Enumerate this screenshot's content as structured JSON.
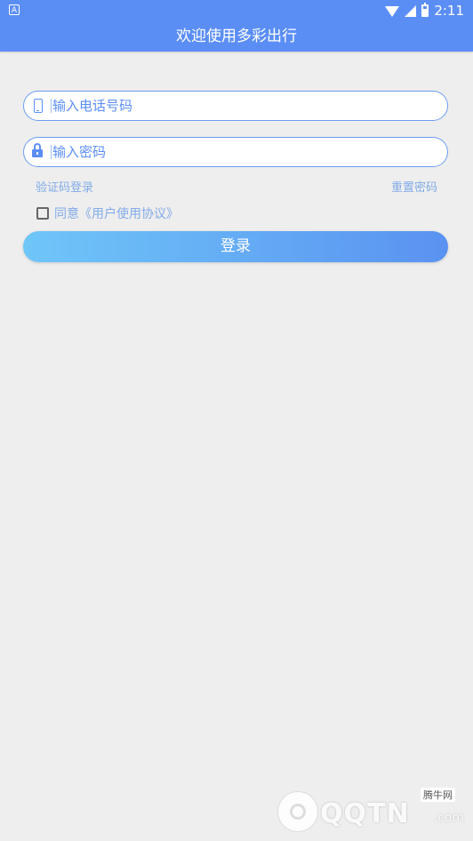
{
  "status_bar": {
    "time": "2:11",
    "notification_badge": "A"
  },
  "app_bar": {
    "title": "欢迎使用多彩出行"
  },
  "form": {
    "phone_placeholder": "输入电话号码",
    "password_placeholder": "输入密码",
    "sms_login_link": "验证码登录",
    "reset_password_link": "重置密码",
    "agree_text": "同意《用户使用协议》",
    "login_button": "登录"
  },
  "watermark": {
    "brand": "QQTN",
    "domain": ".com",
    "badge": "腾牛网"
  },
  "colors": {
    "primary": "#5b8ef5",
    "background": "#eeeeee",
    "link": "#82abe8",
    "button_gradient_start": "#6fc6f8",
    "button_gradient_end": "#5a92f1"
  }
}
